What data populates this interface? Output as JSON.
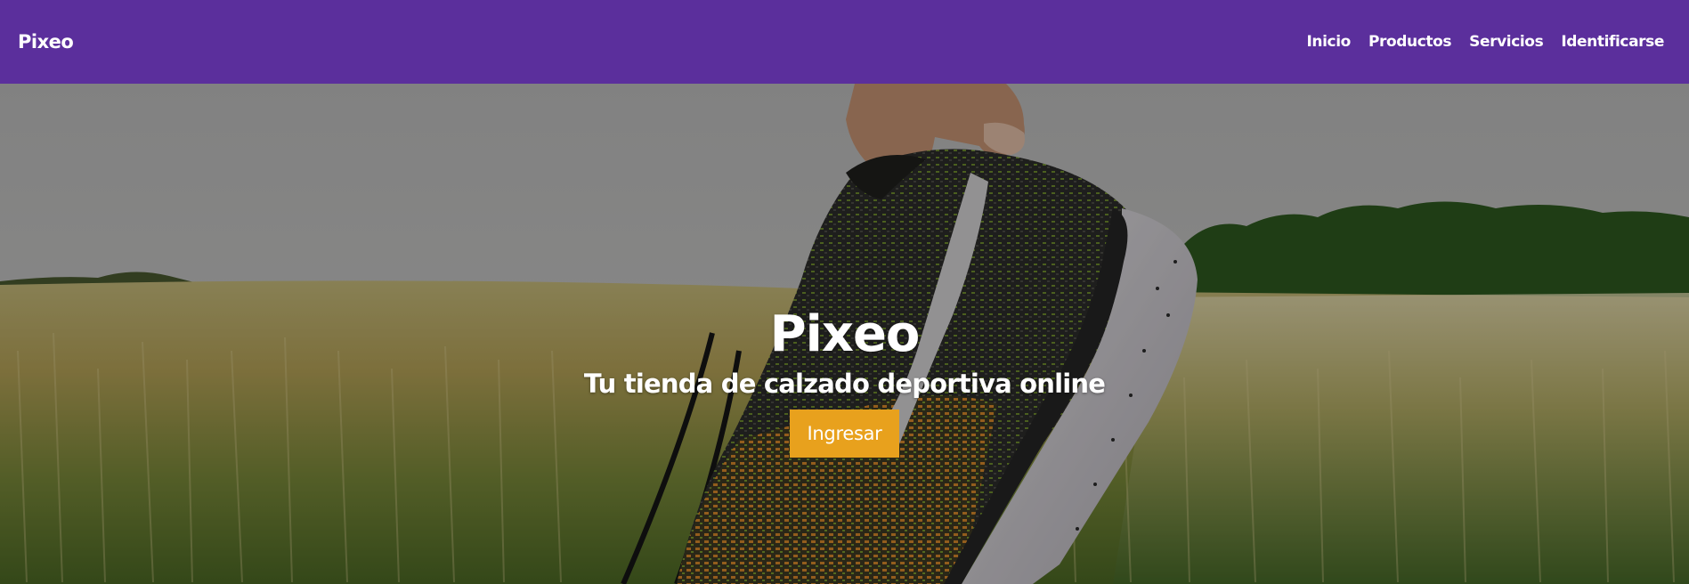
{
  "navbar": {
    "brand": "Pixeo",
    "color": "#5b2f9c",
    "links": [
      {
        "label": "Inicio"
      },
      {
        "label": "Productos"
      },
      {
        "label": "Servicios"
      },
      {
        "label": "Identificarse"
      }
    ]
  },
  "hero": {
    "title": "Pixeo",
    "subtitle": "Tu tienda de calzado deportiva online",
    "button_label": "Ingresar",
    "button_color": "#e8a11d",
    "image": "hand-holding-running-shoe-in-field"
  }
}
